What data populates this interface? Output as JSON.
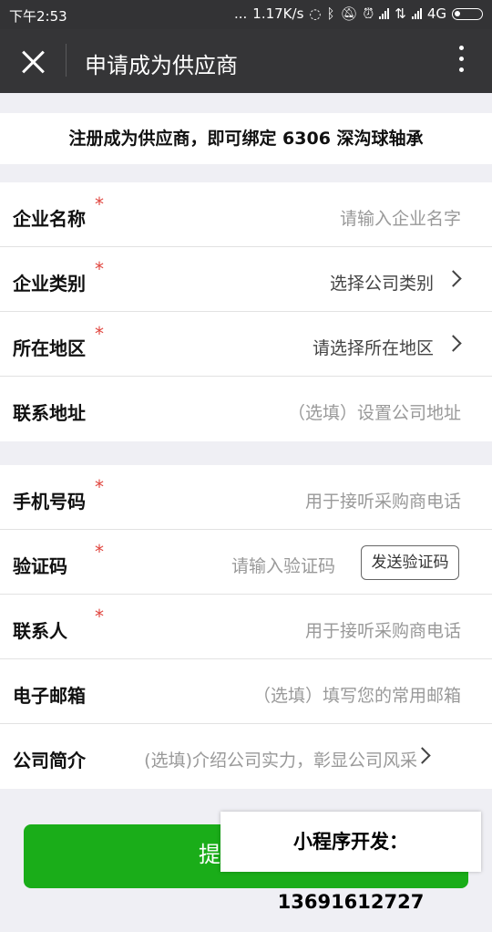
{
  "status_bar": {
    "time": "下午2:53",
    "dots": "...",
    "speed": "1.17K/s",
    "network": "4G"
  },
  "nav": {
    "title": "申请成为供应商"
  },
  "notice": "注册成为供应商，即可绑定 6306 深沟球轴承",
  "form": {
    "company_name": {
      "label": "企业名称",
      "required": "*",
      "placeholder": "请输入企业名字"
    },
    "company_type": {
      "label": "企业类别",
      "required": "*",
      "value": "选择公司类别"
    },
    "region": {
      "label": "所在地区",
      "required": "*",
      "value": "请选择所在地区"
    },
    "address": {
      "label": "联系地址",
      "placeholder": "（选填）设置公司地址"
    },
    "phone": {
      "label": "手机号码",
      "required": "*",
      "placeholder": "用于接听采购商电话"
    },
    "code": {
      "label": "验证码",
      "required": "*",
      "placeholder": "请输入验证码",
      "button": "发送验证码"
    },
    "contact": {
      "label": "联系人",
      "required": "*",
      "placeholder": "用于接听采购商电话"
    },
    "email": {
      "label": "电子邮箱",
      "placeholder": "（选填）填写您的常用邮箱"
    },
    "intro": {
      "label": "公司简介",
      "placeholder": "(选填)介绍公司实力，彰显公司风采"
    }
  },
  "submit_label": "提",
  "watermark": "小程序开发：13691612727",
  "colors": {
    "nav_bg": "#353537",
    "accent_green": "#1aad19",
    "required_red": "#e0463f"
  }
}
